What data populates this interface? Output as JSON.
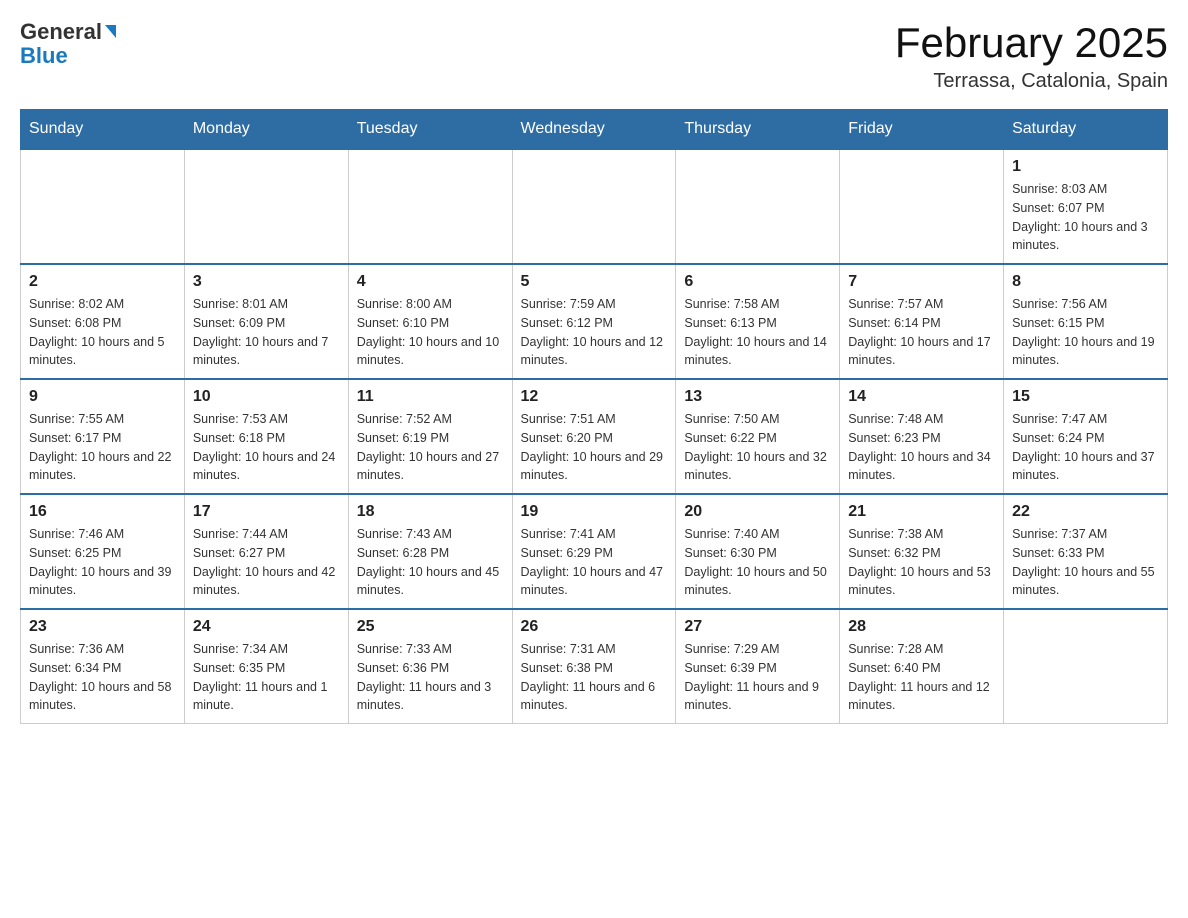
{
  "header": {
    "logo_general": "General",
    "logo_blue": "Blue",
    "month_title": "February 2025",
    "location": "Terrassa, Catalonia, Spain"
  },
  "weekdays": [
    "Sunday",
    "Monday",
    "Tuesday",
    "Wednesday",
    "Thursday",
    "Friday",
    "Saturday"
  ],
  "weeks": [
    [
      {
        "day": "",
        "info": ""
      },
      {
        "day": "",
        "info": ""
      },
      {
        "day": "",
        "info": ""
      },
      {
        "day": "",
        "info": ""
      },
      {
        "day": "",
        "info": ""
      },
      {
        "day": "",
        "info": ""
      },
      {
        "day": "1",
        "info": "Sunrise: 8:03 AM\nSunset: 6:07 PM\nDaylight: 10 hours and 3 minutes."
      }
    ],
    [
      {
        "day": "2",
        "info": "Sunrise: 8:02 AM\nSunset: 6:08 PM\nDaylight: 10 hours and 5 minutes."
      },
      {
        "day": "3",
        "info": "Sunrise: 8:01 AM\nSunset: 6:09 PM\nDaylight: 10 hours and 7 minutes."
      },
      {
        "day": "4",
        "info": "Sunrise: 8:00 AM\nSunset: 6:10 PM\nDaylight: 10 hours and 10 minutes."
      },
      {
        "day": "5",
        "info": "Sunrise: 7:59 AM\nSunset: 6:12 PM\nDaylight: 10 hours and 12 minutes."
      },
      {
        "day": "6",
        "info": "Sunrise: 7:58 AM\nSunset: 6:13 PM\nDaylight: 10 hours and 14 minutes."
      },
      {
        "day": "7",
        "info": "Sunrise: 7:57 AM\nSunset: 6:14 PM\nDaylight: 10 hours and 17 minutes."
      },
      {
        "day": "8",
        "info": "Sunrise: 7:56 AM\nSunset: 6:15 PM\nDaylight: 10 hours and 19 minutes."
      }
    ],
    [
      {
        "day": "9",
        "info": "Sunrise: 7:55 AM\nSunset: 6:17 PM\nDaylight: 10 hours and 22 minutes."
      },
      {
        "day": "10",
        "info": "Sunrise: 7:53 AM\nSunset: 6:18 PM\nDaylight: 10 hours and 24 minutes."
      },
      {
        "day": "11",
        "info": "Sunrise: 7:52 AM\nSunset: 6:19 PM\nDaylight: 10 hours and 27 minutes."
      },
      {
        "day": "12",
        "info": "Sunrise: 7:51 AM\nSunset: 6:20 PM\nDaylight: 10 hours and 29 minutes."
      },
      {
        "day": "13",
        "info": "Sunrise: 7:50 AM\nSunset: 6:22 PM\nDaylight: 10 hours and 32 minutes."
      },
      {
        "day": "14",
        "info": "Sunrise: 7:48 AM\nSunset: 6:23 PM\nDaylight: 10 hours and 34 minutes."
      },
      {
        "day": "15",
        "info": "Sunrise: 7:47 AM\nSunset: 6:24 PM\nDaylight: 10 hours and 37 minutes."
      }
    ],
    [
      {
        "day": "16",
        "info": "Sunrise: 7:46 AM\nSunset: 6:25 PM\nDaylight: 10 hours and 39 minutes."
      },
      {
        "day": "17",
        "info": "Sunrise: 7:44 AM\nSunset: 6:27 PM\nDaylight: 10 hours and 42 minutes."
      },
      {
        "day": "18",
        "info": "Sunrise: 7:43 AM\nSunset: 6:28 PM\nDaylight: 10 hours and 45 minutes."
      },
      {
        "day": "19",
        "info": "Sunrise: 7:41 AM\nSunset: 6:29 PM\nDaylight: 10 hours and 47 minutes."
      },
      {
        "day": "20",
        "info": "Sunrise: 7:40 AM\nSunset: 6:30 PM\nDaylight: 10 hours and 50 minutes."
      },
      {
        "day": "21",
        "info": "Sunrise: 7:38 AM\nSunset: 6:32 PM\nDaylight: 10 hours and 53 minutes."
      },
      {
        "day": "22",
        "info": "Sunrise: 7:37 AM\nSunset: 6:33 PM\nDaylight: 10 hours and 55 minutes."
      }
    ],
    [
      {
        "day": "23",
        "info": "Sunrise: 7:36 AM\nSunset: 6:34 PM\nDaylight: 10 hours and 58 minutes."
      },
      {
        "day": "24",
        "info": "Sunrise: 7:34 AM\nSunset: 6:35 PM\nDaylight: 11 hours and 1 minute."
      },
      {
        "day": "25",
        "info": "Sunrise: 7:33 AM\nSunset: 6:36 PM\nDaylight: 11 hours and 3 minutes."
      },
      {
        "day": "26",
        "info": "Sunrise: 7:31 AM\nSunset: 6:38 PM\nDaylight: 11 hours and 6 minutes."
      },
      {
        "day": "27",
        "info": "Sunrise: 7:29 AM\nSunset: 6:39 PM\nDaylight: 11 hours and 9 minutes."
      },
      {
        "day": "28",
        "info": "Sunrise: 7:28 AM\nSunset: 6:40 PM\nDaylight: 11 hours and 12 minutes."
      },
      {
        "day": "",
        "info": ""
      }
    ]
  ]
}
